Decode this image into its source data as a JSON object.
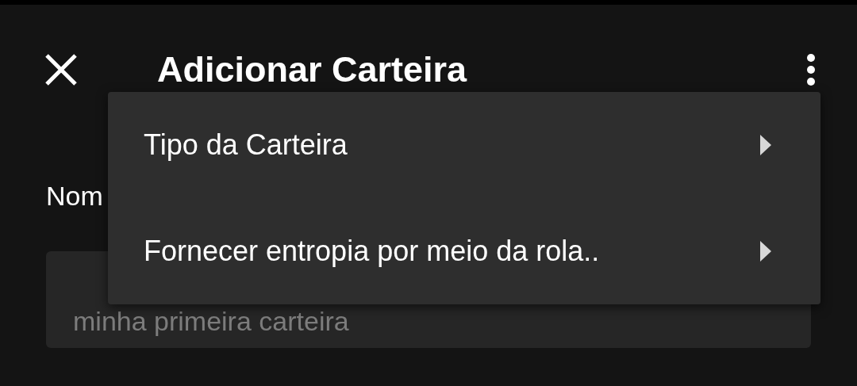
{
  "header": {
    "title": "Adicionar Carteira"
  },
  "form": {
    "label": "Nom",
    "name_field": {
      "placeholder": "minha primeira carteira"
    }
  },
  "menu": {
    "items": [
      {
        "label": "Tipo da Carteira",
        "has_submenu": true
      },
      {
        "label": "Fornecer entropia por meio da rola..",
        "has_submenu": true
      }
    ]
  }
}
